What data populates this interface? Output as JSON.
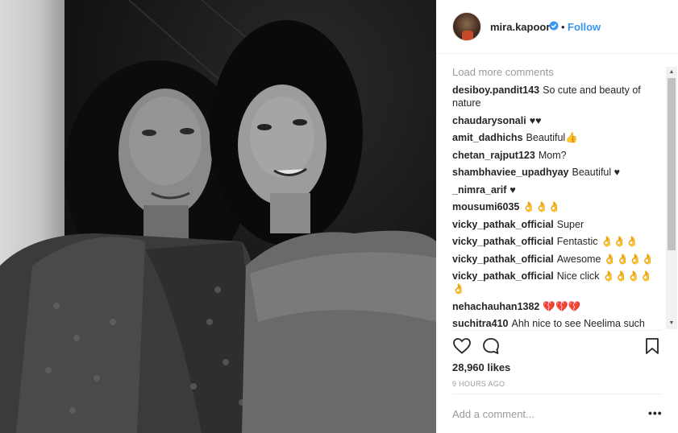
{
  "post": {
    "username": "mira.kapoor",
    "follow_label": "Follow",
    "separator": "•"
  },
  "comments": {
    "load_more": "Load more comments",
    "items": [
      {
        "user": "desiboy.pandit143",
        "text": "So cute and beauty of nature"
      },
      {
        "user": "chaudarysonali",
        "text": "♥♥"
      },
      {
        "user": "amit_dadhichs",
        "text": "Beautiful👍"
      },
      {
        "user": "chetan_rajput123",
        "text": "Mom?"
      },
      {
        "user": "shambhaviee_upadhyay",
        "text": "Beautiful ♥"
      },
      {
        "user": "_nimra_arif",
        "text": "♥"
      },
      {
        "user": "mousumi6035",
        "text": "👌👌👌"
      },
      {
        "user": "vicky_pathak_official",
        "text": "Super"
      },
      {
        "user": "vicky_pathak_official",
        "text": "Fentastic 👌👌👌"
      },
      {
        "user": "vicky_pathak_official",
        "text": "Awesome 👌👌👌👌"
      },
      {
        "user": "vicky_pathak_official",
        "text": "Nice click 👌👌👌👌👌"
      },
      {
        "user": "nehachauhan1382",
        "text": "💔💔💔"
      },
      {
        "user": "suchitra410",
        "text": "Ahh nice to see Neelima such talent wish she did movies ."
      }
    ]
  },
  "engagement": {
    "likes": "28,960 likes",
    "time": "9 HOURS AGO"
  },
  "composer": {
    "placeholder": "Add a comment...",
    "more": "•••"
  },
  "icons": {
    "like": "heart-icon",
    "comment": "comment-bubble-icon",
    "save": "bookmark-icon",
    "verified": "verified-badge-icon",
    "more": "more-options-icon"
  },
  "colors": {
    "link_blue": "#3897f0",
    "text": "#262626",
    "muted": "#999999"
  }
}
